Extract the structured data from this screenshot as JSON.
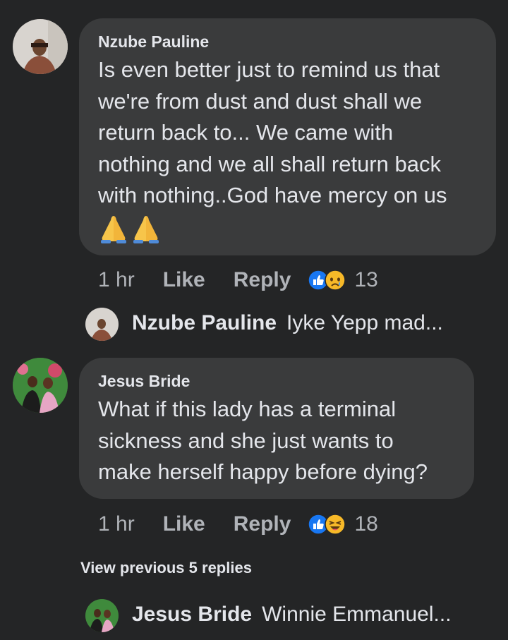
{
  "comments": [
    {
      "author": "Nzube Pauline",
      "text_lines": [
        "Is even better just to remind us that",
        "we're from dust and dust shall we",
        "return back to... We came with",
        "nothing and we all shall return back",
        "with nothing..God have mercy on us"
      ],
      "emoji": [
        "praying-hands",
        "praying-hands"
      ],
      "time": "1 hr",
      "like_label": "Like",
      "reply_label": "Reply",
      "reactions": [
        "like",
        "sad"
      ],
      "reaction_count": "13",
      "reply_preview": {
        "name": "Nzube Pauline",
        "text": "Iyke Yepp mad..."
      }
    },
    {
      "author": "Jesus Bride",
      "text_lines": [
        "What if this lady has a terminal",
        "sickness and she just wants to",
        "make herself happy before dying?"
      ],
      "time": "1 hr",
      "like_label": "Like",
      "reply_label": "Reply",
      "reactions": [
        "like",
        "haha"
      ],
      "reaction_count": "18",
      "view_previous": "View previous 5 replies",
      "reply_preview": {
        "name": "Jesus Bride",
        "text": "Winnie Emmanuel..."
      }
    }
  ],
  "colors": {
    "background": "#242526",
    "bubble": "#3a3b3c",
    "text": "#e4e6eb",
    "meta": "#b0b3b8",
    "like_blue": "#1877f2",
    "emoji_yellow": "#f7b928"
  }
}
